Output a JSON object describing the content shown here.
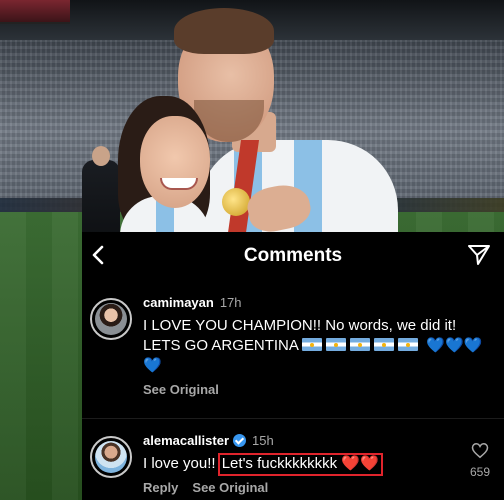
{
  "sheet": {
    "title": "Comments"
  },
  "comments": [
    {
      "username": "camimayan",
      "time": "17h",
      "text_main": "I LOVE YOU CHAMPION!! No words, we did it! LETS GO ARGENTINA",
      "flags_count": 5,
      "hearts": "💙💙💙💙",
      "see_original": "See Original"
    },
    {
      "username": "alemacallister",
      "verified": true,
      "time": "15h",
      "text_prefix": "I love you!!",
      "text_highlighted": "Let's fuckkkkkkkk",
      "hearts": "❤️❤️",
      "reply": "Reply",
      "see_original": "See Original",
      "like_count": "659"
    }
  ],
  "colors": {
    "sheet_background": "#000000",
    "secondary_text": "#a8a8a8",
    "highlight_border": "#e0242c",
    "verified_badge": "#3897f0"
  },
  "icons": {
    "back": "chevron-left-icon",
    "share": "send-icon",
    "like": "heart-outline-icon"
  }
}
